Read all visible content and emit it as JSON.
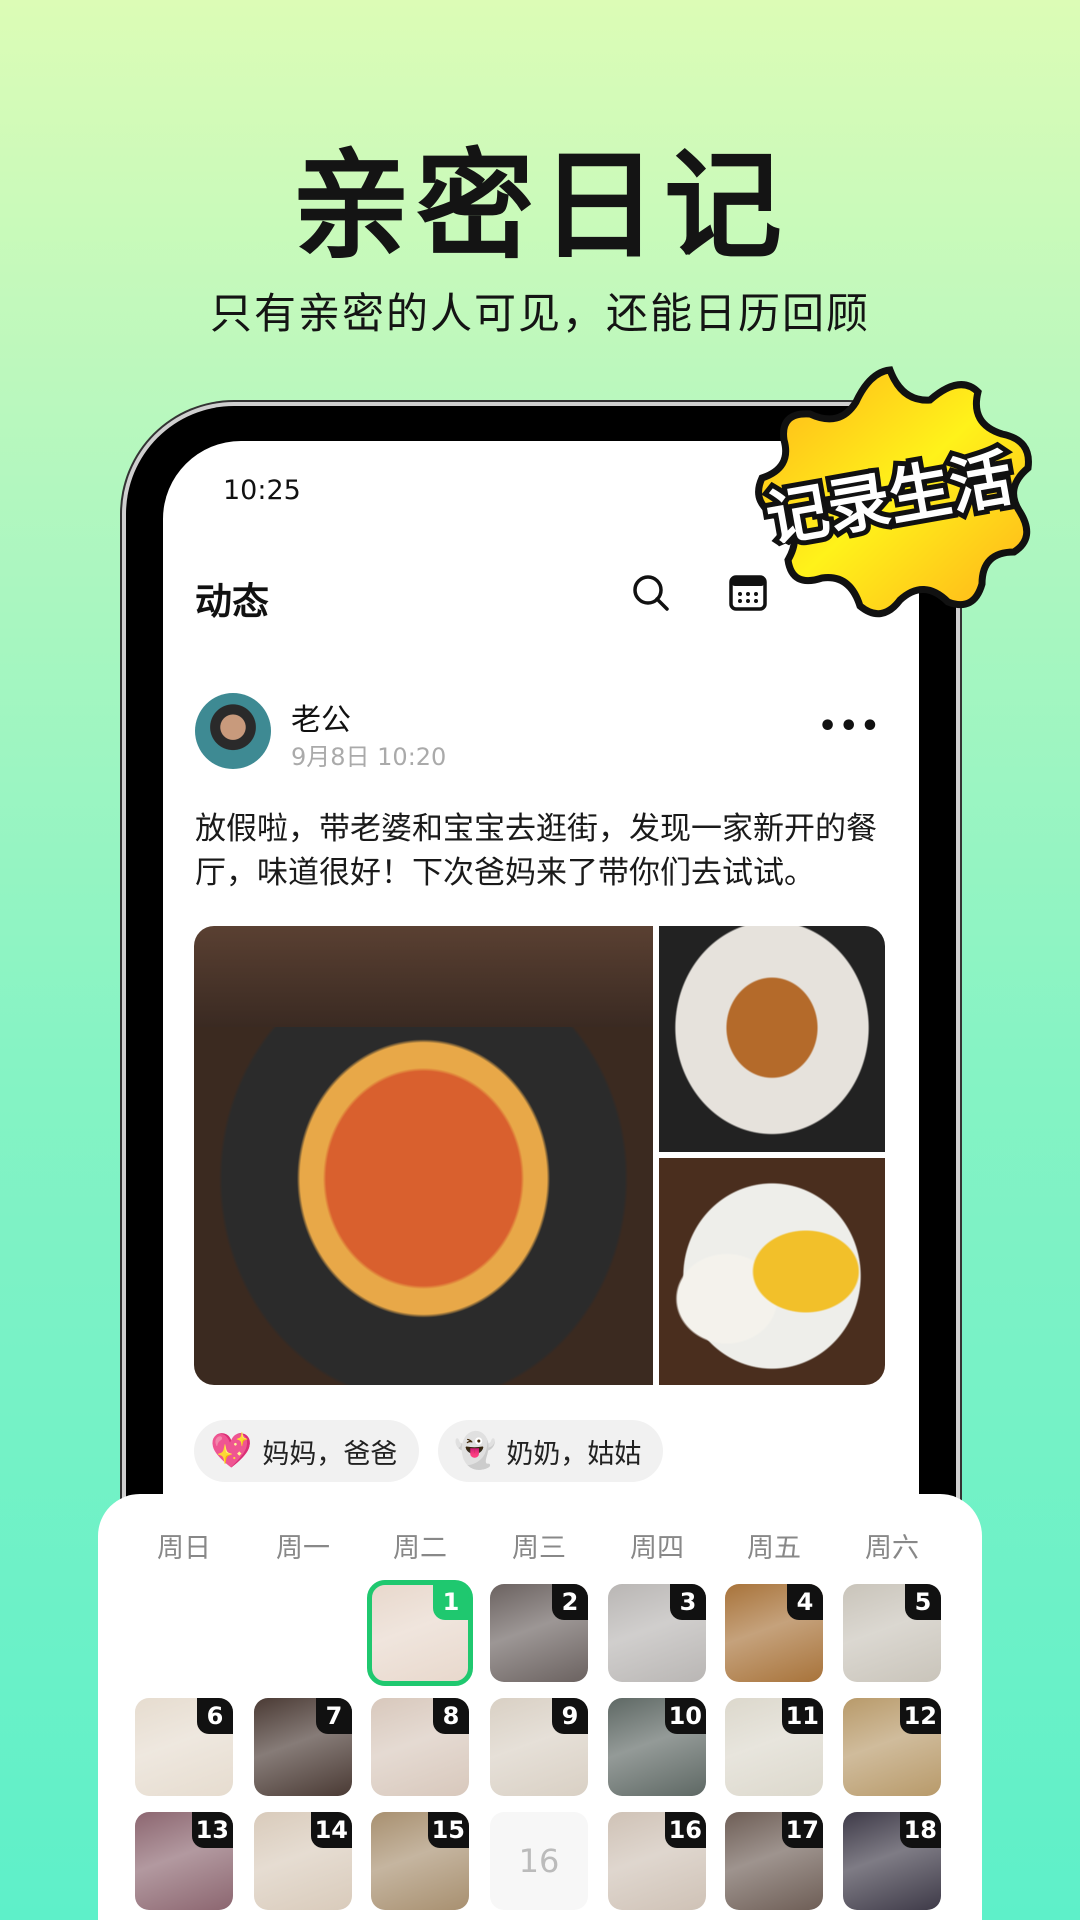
{
  "hero": {
    "title": "亲密日记",
    "subtitle": "只有亲密的人可见，还能日历回顾",
    "badge": "记录生活"
  },
  "colors": {
    "accent": "#1fc86f",
    "badge_yellow": "#ffd21a",
    "background_top": "#dcfcb6",
    "background_bottom": "#5ef0c9"
  },
  "status_bar": {
    "time": "10:25"
  },
  "header": {
    "title": "动态",
    "icons": [
      "search-icon",
      "calendar-icon"
    ]
  },
  "post": {
    "author": "老公",
    "date": "9月8日 10:20",
    "text": "放假啦，带老婆和宝宝去逛街，发现一家新开的餐厅，味道很好！下次爸妈来了带你们去试试。",
    "images": [
      "sweet-and-sour-pork",
      "fried-chicken",
      "mango-sticky-rice"
    ],
    "visibility": [
      {
        "emoji": "💖",
        "label": "妈妈，爸爸"
      },
      {
        "emoji": "👻",
        "label": "奶奶，姑姑"
      }
    ]
  },
  "calendar": {
    "weekdays": [
      "周日",
      "周一",
      "周二",
      "周三",
      "周四",
      "周五",
      "周六"
    ],
    "selected_day": "1",
    "cells": [
      {
        "day": "1",
        "photo": true,
        "c": "#e8d8cc"
      },
      {
        "day": "2",
        "photo": true,
        "c": "#6b6260"
      },
      {
        "day": "3",
        "photo": true,
        "c": "#b9b6b4"
      },
      {
        "day": "4",
        "photo": true,
        "c": "#a8733a"
      },
      {
        "day": "5",
        "photo": true,
        "c": "#c9c4ba"
      },
      {
        "day": "6",
        "photo": true,
        "c": "#e6dccf"
      },
      {
        "day": "7",
        "photo": true,
        "c": "#4a3a34"
      },
      {
        "day": "8",
        "photo": true,
        "c": "#d8c8bc"
      },
      {
        "day": "9",
        "photo": true,
        "c": "#d9d0c4"
      },
      {
        "day": "10",
        "photo": true,
        "c": "#5e6864"
      },
      {
        "day": "11",
        "photo": true,
        "c": "#dcd8cc"
      },
      {
        "day": "12",
        "photo": true,
        "c": "#b89a6a"
      },
      {
        "day": "13",
        "photo": true,
        "c": "#8c6670"
      },
      {
        "day": "14",
        "photo": true,
        "c": "#d9cbbb"
      },
      {
        "day": "15",
        "photo": true,
        "c": "#a89070"
      },
      {
        "day": "16",
        "photo": false
      },
      {
        "day": "16",
        "photo": true,
        "c": "#cfc2b6"
      },
      {
        "day": "17",
        "photo": true,
        "c": "#6e5e56"
      },
      {
        "day": "18",
        "photo": true,
        "c": "#3e3a48"
      }
    ]
  }
}
